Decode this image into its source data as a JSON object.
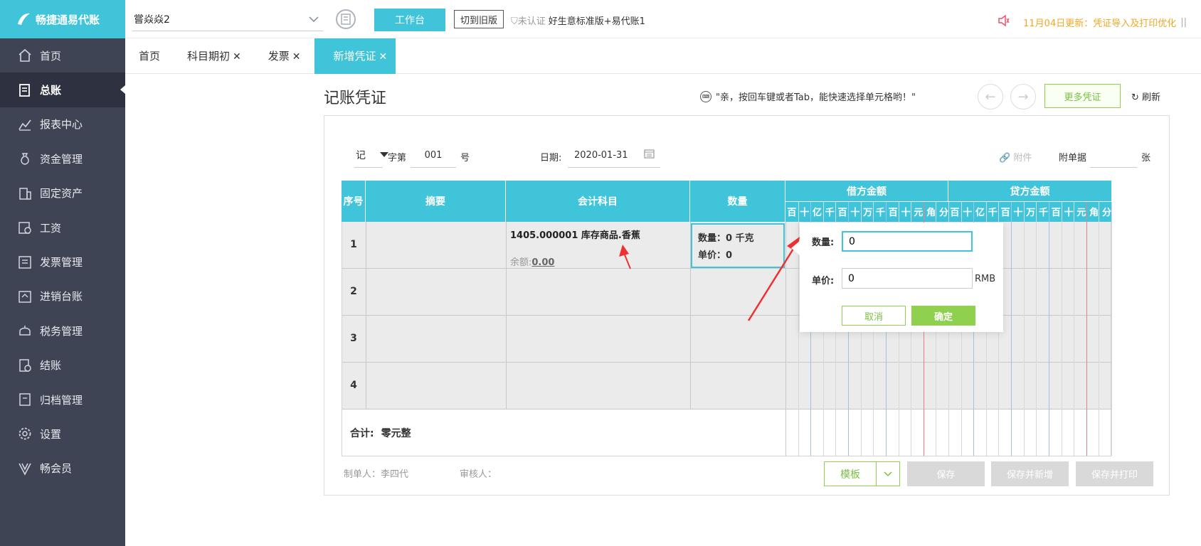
{
  "app": {
    "name": "畅捷通易代账"
  },
  "sidebar": {
    "items": [
      {
        "label": "首页",
        "icon": "home-icon"
      },
      {
        "label": "总账",
        "icon": "ledger-icon",
        "active": true
      },
      {
        "label": "报表中心",
        "icon": "chart-icon"
      },
      {
        "label": "资金管理",
        "icon": "money-bag-icon"
      },
      {
        "label": "固定资产",
        "icon": "building-icon"
      },
      {
        "label": "工资",
        "icon": "salary-icon"
      },
      {
        "label": "发票管理",
        "icon": "invoice-icon"
      },
      {
        "label": "进销台账",
        "icon": "inventory-icon"
      },
      {
        "label": "税务管理",
        "icon": "tax-icon"
      },
      {
        "label": "结账",
        "icon": "closing-icon"
      },
      {
        "label": "归档管理",
        "icon": "archive-icon"
      },
      {
        "label": "设置",
        "icon": "gear-icon"
      },
      {
        "label": "畅会员",
        "icon": "vip-icon"
      }
    ]
  },
  "topbar": {
    "company": "嘗焱焱2",
    "workbench_label": "工作台",
    "old_version_label": "切到旧版",
    "cert_label": "未认证",
    "version_label": "好生意标准版+易代账1",
    "notice": "11月04日更新：凭证导入及打印优化"
  },
  "tabs": [
    {
      "label": "首页",
      "closable": false
    },
    {
      "label": "科目期初",
      "closable": true
    },
    {
      "label": "发票",
      "closable": true
    },
    {
      "label": "新增凭证",
      "closable": true,
      "active": true
    }
  ],
  "voucher": {
    "title": "记账凭证",
    "tip": "\"亲，按回车键或者Tab，能快速选择单元格哟！\"",
    "more_label": "更多凭证",
    "refresh_label": "刷新",
    "type": "记",
    "zi_label": "字第",
    "number": "001",
    "hao_label": "号",
    "date_label": "日期:",
    "date": "2020-01-31",
    "attach_label": "附件",
    "doc_label": "附单据",
    "doc_unit": "张"
  },
  "table": {
    "headers": {
      "seq": "序号",
      "summary": "摘要",
      "account": "会计科目",
      "quantity": "数量",
      "debit": "借方金额",
      "credit": "贷方金额"
    },
    "digit_units": [
      "百",
      "十",
      "亿",
      "千",
      "百",
      "十",
      "万",
      "千",
      "百",
      "十",
      "元",
      "角",
      "分"
    ],
    "rows": [
      {
        "seq": "1",
        "account": "1405.000001 库存商品.香蕉",
        "balance_label": "余额:",
        "balance": "0.00",
        "qty_line": "数量：0 千克",
        "price_line": "单价：0"
      },
      {
        "seq": "2"
      },
      {
        "seq": "3"
      },
      {
        "seq": "4"
      }
    ],
    "total_label": "合计:",
    "total_amount": "零元整"
  },
  "popup": {
    "qty_label": "数量:",
    "qty_value": "0",
    "price_label": "单价:",
    "price_value": "0",
    "unit": "RMB",
    "cancel": "取消",
    "ok": "确定"
  },
  "footer": {
    "maker": "制单人：李四代",
    "reviewer": "审核人：",
    "template": "模板",
    "save": "保存",
    "save_new": "保存并新增",
    "save_print": "保存并打印"
  },
  "colors": {
    "accent": "#40c4da",
    "green": "#8fd14f",
    "sidebar": "#3f4455",
    "annotation_arrow": "#f03030"
  }
}
